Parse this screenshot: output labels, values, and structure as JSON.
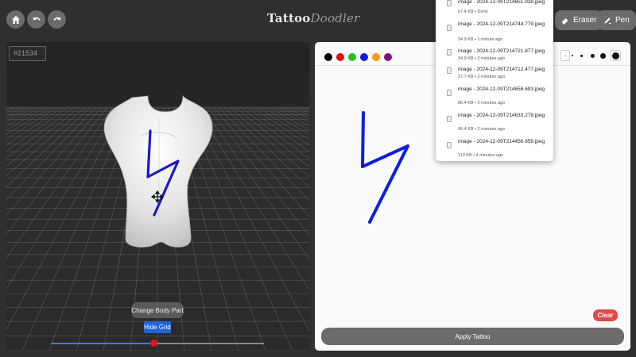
{
  "nav": {
    "home_icon": "home-icon",
    "undo_icon": "undo-icon",
    "redo_icon": "redo-icon"
  },
  "logo": {
    "part1": "Tattoo",
    "part2": "Doodler"
  },
  "tools": {
    "eraser_label": "Eraser",
    "eraser_icon": "eraser-icon",
    "pen_label": "Pen",
    "pen_icon": "pen-icon"
  },
  "viewer": {
    "color_value": "#21534",
    "change_body_part_label": "Change Body Part",
    "hide_grid_label": "Hide Grid",
    "slider_value": 0.48
  },
  "drawing": {
    "colors": [
      "#000000",
      "#e01010",
      "#22c322",
      "#0a1ee0",
      "#f39c12",
      "#7d1380"
    ],
    "brush_sizes": [
      1,
      2,
      3,
      5,
      7,
      9
    ],
    "stroke_color": "#0a1ee0",
    "clear_label": "Clear",
    "apply_label": "Apply Tattoo"
  },
  "downloads": {
    "items": [
      {
        "name": "image - 2024-12-09T214851.938.jpeg",
        "meta": "67.4 KB • Done"
      },
      {
        "name": "image - 2024-12-09T214744.779.jpeg",
        "meta": "34.9 KB • 1 minute ago"
      },
      {
        "name": "image - 2024-12-09T214721.877.jpeg",
        "meta": "34.9 KB • 2 minutes ago"
      },
      {
        "name": "image - 2024-12-09T214712.477.jpeg",
        "meta": "27.7 KB • 2 minutes ago"
      },
      {
        "name": "image - 2024-12-09T214658.693.jpeg",
        "meta": "86.4 KB • 2 minutes ago"
      },
      {
        "name": "image - 2024-12-09T214633.278.jpeg",
        "meta": "90.4 KB • 2 minutes ago"
      },
      {
        "name": "image - 2024-12-09T214456.859.jpeg",
        "meta": "113 KB • 4 minutes ago"
      }
    ]
  }
}
